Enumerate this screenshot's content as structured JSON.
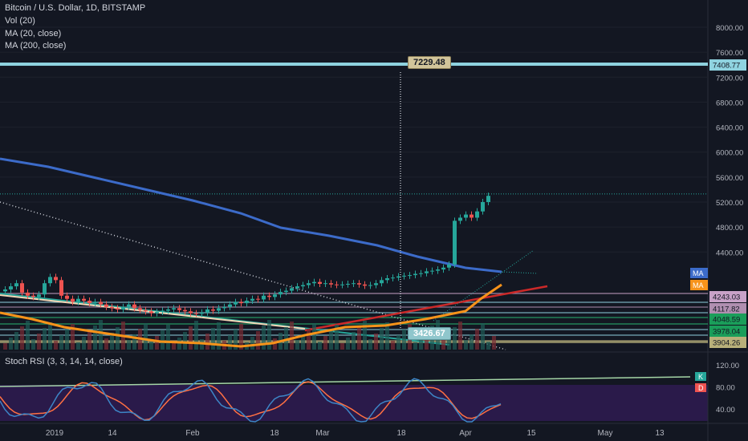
{
  "chart_title": "Bitcoin / U.S. Dollar, 1D, BITSTAMP",
  "indicators": [
    "Vol (20)",
    "MA (20, close)",
    "MA (200, close)"
  ],
  "rsi_title": "Stoch RSI (3, 3, 14, 14, close)",
  "colors": {
    "background": "#131722",
    "up": "#26a69a",
    "down": "#ef5350",
    "ma20": "#f7931a",
    "ma200": "#3c6bc9",
    "horizontal_line": "#8fd3e0",
    "stoch_k": "#3d85c6",
    "stoch_d": "#ff7043",
    "rsi_band": "#2a1a4a"
  },
  "chart_data": {
    "type": "candlestick",
    "title": "Bitcoin / U.S. Dollar, 1D, BITSTAMP",
    "y_axis_ticks": [
      8000,
      7600,
      7200,
      6800,
      6400,
      6000,
      5600,
      5200,
      4800,
      4400
    ],
    "y_tick_labels": [
      "8000.00",
      "7600.00",
      "7200.00",
      "6800.00",
      "6400.00",
      "6000.00",
      "5600.00",
      "5200.00",
      "4800.00",
      "4400.00"
    ],
    "x_axis_labels": [
      "2019",
      "14",
      "Feb",
      "18",
      "Mar",
      "18",
      "Apr",
      "15",
      "May",
      "13"
    ],
    "price_labels": [
      {
        "value": "7408.77",
        "color": "#8fd3e0"
      },
      {
        "value": "4243.03",
        "color": "#c8a2c8"
      },
      {
        "value": "4117.82",
        "color": "#b08fb0"
      },
      {
        "value": "4048.59",
        "color": "#1a9e5a"
      },
      {
        "value": "3978.04",
        "color": "#1a9e5a"
      },
      {
        "value": "3904.26",
        "color": "#b8b07a"
      }
    ],
    "ma_tags": [
      {
        "label": "MA",
        "color": "#3c6bc9"
      },
      {
        "label": "MA",
        "color": "#f7931a"
      }
    ],
    "callouts": {
      "top": "7229.48",
      "bottom": "3426.67"
    },
    "horizontal_line": 7408.77,
    "rsi_axis_ticks": [
      120,
      80,
      40
    ],
    "rsi_tick_labels": [
      "120.00",
      "80.00",
      "40.00"
    ],
    "rsi_tags": [
      {
        "label": "K",
        "color": "#26a69a"
      },
      {
        "label": "D",
        "color": "#ef5350"
      }
    ],
    "candles_close": [
      3800,
      3850,
      3900,
      3750,
      3700,
      3680,
      3720,
      3900,
      4000,
      3950,
      3700,
      3650,
      3600,
      3650,
      3620,
      3580,
      3600,
      3560,
      3520,
      3500,
      3480,
      3520,
      3560,
      3500,
      3470,
      3450,
      3420,
      3440,
      3460,
      3480,
      3500,
      3470,
      3450,
      3420,
      3410,
      3430,
      3480,
      3460,
      3500,
      3520,
      3560,
      3600,
      3580,
      3620,
      3650,
      3640,
      3700,
      3680,
      3720,
      3760,
      3780,
      3820,
      3850,
      3870,
      3900,
      3920,
      3890,
      3900,
      3880,
      3870,
      3880,
      3890,
      3900,
      3880,
      3860,
      3870,
      3900,
      3950,
      3980,
      3990,
      4010,
      4020,
      4030,
      4050,
      4060,
      4090,
      4100,
      4120,
      4150,
      4200,
      4900,
      4950,
      5000,
      4950,
      5050,
      5200,
      5300
    ]
  }
}
